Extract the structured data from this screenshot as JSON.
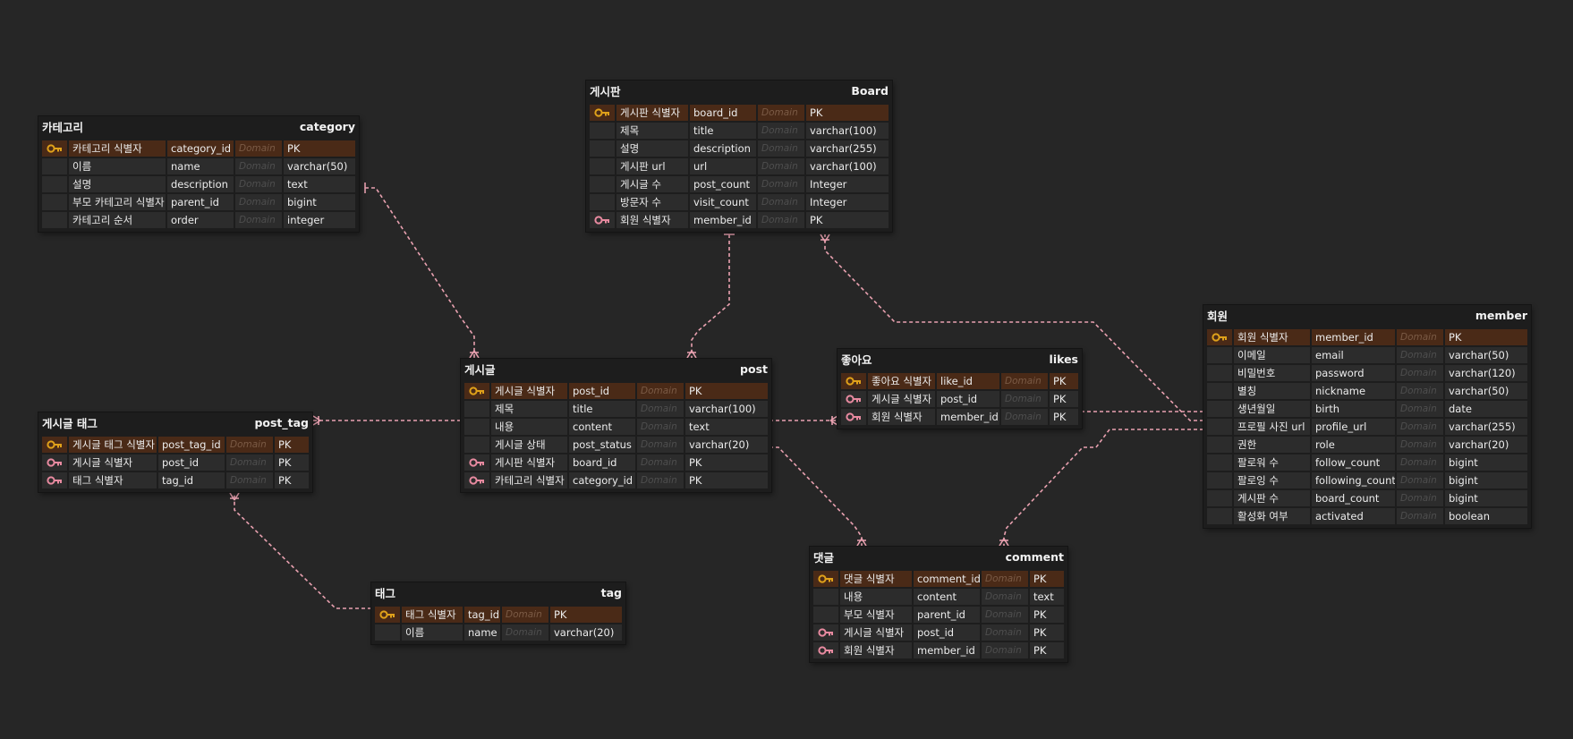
{
  "colors": {
    "background": "#262626",
    "table_bg": "#1d1d1d",
    "cell_bg": "#2c2c2c",
    "pk_row_bg": "#4a2a17",
    "pk_key": "#e0a11a",
    "fk_key": "#e88aa0",
    "relation_line": "#e9a1b0"
  },
  "tables": [
    {
      "id": "category",
      "name_logical": "카테고리",
      "name_physical": "category",
      "columns": [
        {
          "logical": "카테고리 식별자",
          "physical": "category_id",
          "domain": "Domain",
          "type": "PK",
          "key": "pk"
        },
        {
          "logical": "이름",
          "physical": "name",
          "domain": "Domain",
          "type": "varchar(50)",
          "key": ""
        },
        {
          "logical": "설명",
          "physical": "description",
          "domain": "Domain",
          "type": "text",
          "key": ""
        },
        {
          "logical": "부모 카테고리 식별자",
          "physical": "parent_id",
          "domain": "Domain",
          "type": "bigint",
          "key": ""
        },
        {
          "logical": "카테고리 순서",
          "physical": "order",
          "domain": "Domain",
          "type": "integer",
          "key": ""
        }
      ]
    },
    {
      "id": "board",
      "name_logical": "게시판",
      "name_physical": "Board",
      "columns": [
        {
          "logical": "게시판 식별자",
          "physical": "board_id",
          "domain": "Domain",
          "type": "PK",
          "key": "pk"
        },
        {
          "logical": "제목",
          "physical": "title",
          "domain": "Domain",
          "type": "varchar(100)",
          "key": ""
        },
        {
          "logical": "설명",
          "physical": "description",
          "domain": "Domain",
          "type": "varchar(255)",
          "key": ""
        },
        {
          "logical": "게시판 url",
          "physical": "url",
          "domain": "Domain",
          "type": "varchar(100)",
          "key": ""
        },
        {
          "logical": "게시글 수",
          "physical": "post_count",
          "domain": "Domain",
          "type": "Integer",
          "key": ""
        },
        {
          "logical": "방문자 수",
          "physical": "visit_count",
          "domain": "Domain",
          "type": "Integer",
          "key": ""
        },
        {
          "logical": "회원 식별자",
          "physical": "member_id",
          "domain": "Domain",
          "type": "PK",
          "key": "fk"
        }
      ]
    },
    {
      "id": "member",
      "name_logical": "회원",
      "name_physical": "member",
      "columns": [
        {
          "logical": "회원 식별자",
          "physical": "member_id",
          "domain": "Domain",
          "type": "PK",
          "key": "pk"
        },
        {
          "logical": "이메일",
          "physical": "email",
          "domain": "Domain",
          "type": "varchar(50)",
          "key": ""
        },
        {
          "logical": "비밀번호",
          "physical": "password",
          "domain": "Domain",
          "type": "varchar(120)",
          "key": ""
        },
        {
          "logical": "별칭",
          "physical": "nickname",
          "domain": "Domain",
          "type": "varchar(50)",
          "key": ""
        },
        {
          "logical": "생년월일",
          "physical": "birth",
          "domain": "Domain",
          "type": "date",
          "key": ""
        },
        {
          "logical": "프로필 사진 url",
          "physical": "profile_url",
          "domain": "Domain",
          "type": "varchar(255)",
          "key": ""
        },
        {
          "logical": "권한",
          "physical": "role",
          "domain": "Domain",
          "type": "varchar(20)",
          "key": ""
        },
        {
          "logical": "팔로워 수",
          "physical": "follow_count",
          "domain": "Domain",
          "type": "bigint",
          "key": ""
        },
        {
          "logical": "팔로잉 수",
          "physical": "following_count",
          "domain": "Domain",
          "type": "bigint",
          "key": ""
        },
        {
          "logical": "게시판 수",
          "physical": "board_count",
          "domain": "Domain",
          "type": "bigint",
          "key": ""
        },
        {
          "logical": "활성화 여부",
          "physical": "activated",
          "domain": "Domain",
          "type": "boolean",
          "key": ""
        }
      ]
    },
    {
      "id": "post",
      "name_logical": "게시글",
      "name_physical": "post",
      "columns": [
        {
          "logical": "게시글 식별자",
          "physical": "post_id",
          "domain": "Domain",
          "type": "PK",
          "key": "pk"
        },
        {
          "logical": "제목",
          "physical": "title",
          "domain": "Domain",
          "type": "varchar(100)",
          "key": ""
        },
        {
          "logical": "내용",
          "physical": "content",
          "domain": "Domain",
          "type": "text",
          "key": ""
        },
        {
          "logical": "게시글 상태",
          "physical": "post_status",
          "domain": "Domain",
          "type": "varchar(20)",
          "key": ""
        },
        {
          "logical": "게시판 식별자",
          "physical": "board_id",
          "domain": "Domain",
          "type": "PK",
          "key": "fk"
        },
        {
          "logical": "카테고리 식별자",
          "physical": "category_id",
          "domain": "Domain",
          "type": "PK",
          "key": "fk"
        }
      ]
    },
    {
      "id": "likes",
      "name_logical": "좋아요",
      "name_physical": "likes",
      "columns": [
        {
          "logical": "좋아요 식별자",
          "physical": "like_id",
          "domain": "Domain",
          "type": "PK",
          "key": "pk"
        },
        {
          "logical": "게시글 식별자",
          "physical": "post_id",
          "domain": "Domain",
          "type": "PK",
          "key": "fk"
        },
        {
          "logical": "회원 식별자",
          "physical": "member_id",
          "domain": "Domain",
          "type": "PK",
          "key": "fk"
        }
      ]
    },
    {
      "id": "post_tag",
      "name_logical": "게시글 태그",
      "name_physical": "post_tag",
      "columns": [
        {
          "logical": "게시글 태그 식별자",
          "physical": "post_tag_id",
          "domain": "Domain",
          "type": "PK",
          "key": "pk"
        },
        {
          "logical": "게시글 식별자",
          "physical": "post_id",
          "domain": "Domain",
          "type": "PK",
          "key": "fk"
        },
        {
          "logical": "태그 식별자",
          "physical": "tag_id",
          "domain": "Domain",
          "type": "PK",
          "key": "fk"
        }
      ]
    },
    {
      "id": "tag",
      "name_logical": "태그",
      "name_physical": "tag",
      "columns": [
        {
          "logical": "태그 식별자",
          "physical": "tag_id",
          "domain": "Domain",
          "type": "PK",
          "key": "pk"
        },
        {
          "logical": "이름",
          "physical": "name",
          "domain": "Domain",
          "type": "varchar(20)",
          "key": ""
        }
      ]
    },
    {
      "id": "comment",
      "name_logical": "댓글",
      "name_physical": "comment",
      "columns": [
        {
          "logical": "댓글 식별자",
          "physical": "comment_id",
          "domain": "Domain",
          "type": "PK",
          "key": "pk"
        },
        {
          "logical": "내용",
          "physical": "content",
          "domain": "Domain",
          "type": "text",
          "key": ""
        },
        {
          "logical": "부모 식별자",
          "physical": "parent_id",
          "domain": "Domain",
          "type": "PK",
          "key": ""
        },
        {
          "logical": "게시글 식별자",
          "physical": "post_id",
          "domain": "Domain",
          "type": "PK",
          "key": "fk"
        },
        {
          "logical": "회원 식별자",
          "physical": "member_id",
          "domain": "Domain",
          "type": "PK",
          "key": "fk"
        }
      ]
    }
  ],
  "relationships": [
    {
      "id": "category-post",
      "from": "category",
      "to": "post"
    },
    {
      "id": "board-post",
      "from": "board",
      "to": "post"
    },
    {
      "id": "member-board",
      "from": "member",
      "to": "board"
    },
    {
      "id": "post-post_tag",
      "from": "post",
      "to": "post_tag"
    },
    {
      "id": "tag-post_tag",
      "from": "tag",
      "to": "post_tag"
    },
    {
      "id": "post-likes",
      "from": "post",
      "to": "likes"
    },
    {
      "id": "member-likes",
      "from": "member",
      "to": "likes"
    },
    {
      "id": "post-comment",
      "from": "post",
      "to": "comment"
    },
    {
      "id": "member-comment",
      "from": "member",
      "to": "comment"
    }
  ]
}
